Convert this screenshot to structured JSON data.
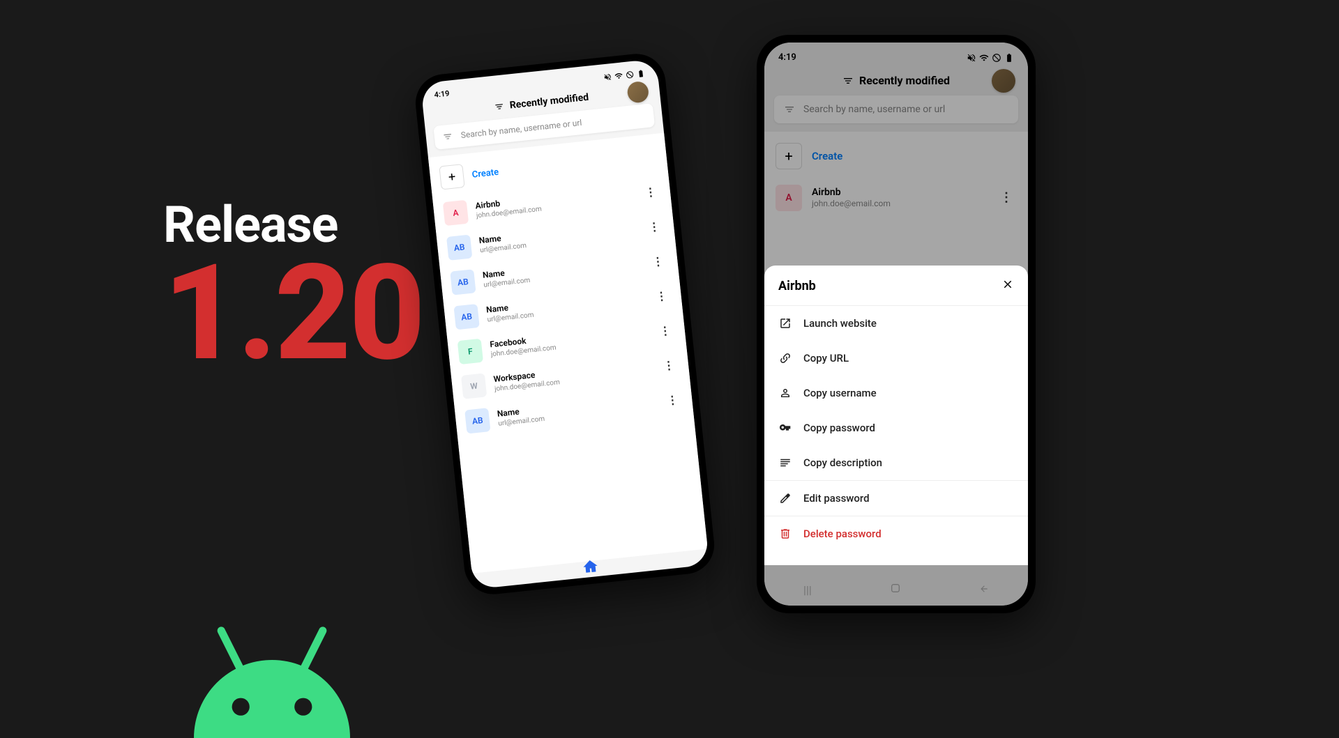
{
  "title": {
    "release_label": "Release",
    "version": "1.20"
  },
  "phone1": {
    "time": "4:19",
    "header_label": "Recently modified",
    "search_placeholder": "Search by name, username or url",
    "create_label": "Create",
    "items": [
      {
        "avatar": "A",
        "avatar_class": "av-pink",
        "name": "Airbnb",
        "sub": "john.doe@email.com"
      },
      {
        "avatar": "AB",
        "avatar_class": "av-blue",
        "name": "Name",
        "sub": "url@email.com"
      },
      {
        "avatar": "AB",
        "avatar_class": "av-blue",
        "name": "Name",
        "sub": "url@email.com"
      },
      {
        "avatar": "AB",
        "avatar_class": "av-blue",
        "name": "Name",
        "sub": "url@email.com"
      },
      {
        "avatar": "F",
        "avatar_class": "av-green",
        "name": "Facebook",
        "sub": "john.doe@email.com"
      },
      {
        "avatar": "W",
        "avatar_class": "av-gray",
        "name": "Workspace",
        "sub": "john.doe@email.com"
      },
      {
        "avatar": "AB",
        "avatar_class": "av-blue",
        "name": "Name",
        "sub": "url@email.com"
      }
    ]
  },
  "phone2": {
    "time": "4:19",
    "header_label": "Recently modified",
    "search_placeholder": "Search by name, username or url",
    "create_label": "Create",
    "items": [
      {
        "avatar": "A",
        "avatar_class": "av-pink",
        "name": "Airbnb",
        "sub": "john.doe@email.com"
      }
    ],
    "sheet": {
      "title": "Airbnb",
      "actions": {
        "launch": "Launch website",
        "copy_url": "Copy URL",
        "copy_user": "Copy username",
        "copy_pass": "Copy password",
        "copy_desc": "Copy description",
        "edit": "Edit password",
        "delete": "Delete password"
      }
    }
  }
}
